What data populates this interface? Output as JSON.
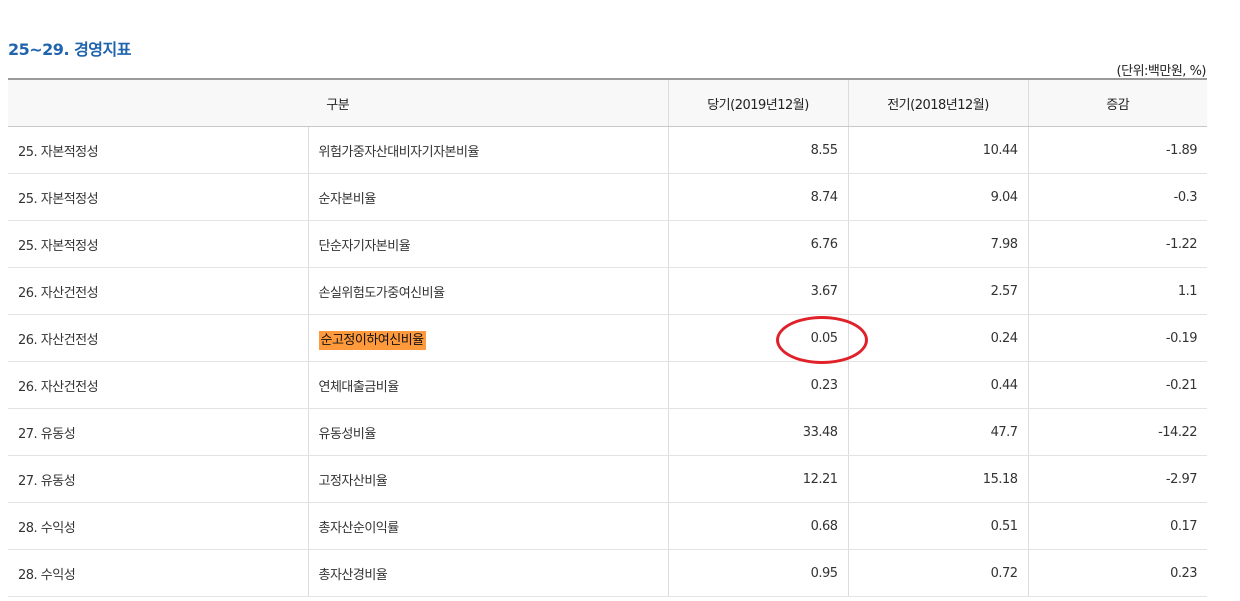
{
  "page": {
    "title": "25~29. 경영지표",
    "unit_note": "(단위:백만원, %)"
  },
  "table": {
    "headers": [
      "구분",
      "당기(2019년12월)",
      "전기(2018년12월)",
      "증감"
    ],
    "rows": [
      {
        "category": "25. 자본적정성",
        "item": "위험가중자산대비자기자본비율",
        "current": "8.55",
        "previous": "10.44",
        "change": "-1.89"
      },
      {
        "category": "25. 자본적정성",
        "item": "순자본비율",
        "current": "8.74",
        "previous": "9.04",
        "change": "-0.3"
      },
      {
        "category": "25. 자본적정성",
        "item": "단순자기자본비율",
        "current": "6.76",
        "previous": "7.98",
        "change": "-1.22"
      },
      {
        "category": "26. 자산건전성",
        "item": "손실위험도가중여신비율",
        "current": "3.67",
        "previous": "2.57",
        "change": "1.1"
      },
      {
        "category": "26. 자산건전성",
        "item": "순고정이하여신비율",
        "current": "0.05",
        "previous": "0.24",
        "change": "-0.19"
      },
      {
        "category": "26. 자산건전성",
        "item": "연체대출금비율",
        "current": "0.23",
        "previous": "0.44",
        "change": "-0.21"
      },
      {
        "category": "27. 유동성",
        "item": "유동성비율",
        "current": "33.48",
        "previous": "47.7",
        "change": "-14.22"
      },
      {
        "category": "27. 유동성",
        "item": "고정자산비율",
        "current": "12.21",
        "previous": "15.18",
        "change": "-2.97"
      },
      {
        "category": "28. 수익성",
        "item": "총자산순이익률",
        "current": "0.68",
        "previous": "0.51",
        "change": "0.17"
      },
      {
        "category": "28. 수익성",
        "item": "총자산경비율",
        "current": "0.95",
        "previous": "0.72",
        "change": "0.23"
      }
    ]
  },
  "annotations": {
    "highlight_color": "#ff9a3c",
    "circle_color": "#e0212a"
  }
}
